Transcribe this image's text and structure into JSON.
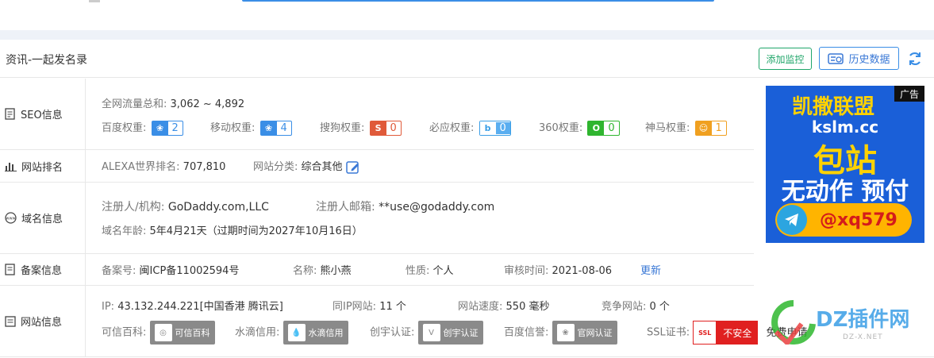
{
  "header": {
    "title": "资讯-一起发名录",
    "monitor_button": "添加监控",
    "history_button": "历史数据"
  },
  "seo": {
    "label": "SEO信息",
    "traffic_label": "全网流量总和:",
    "traffic_value": "3,062 ~ 4,892",
    "weights": [
      {
        "name": "百度权重:",
        "value": "2",
        "icon": "paw-icon",
        "color": "#3a8ee6"
      },
      {
        "name": "移动权重:",
        "value": "4",
        "icon": "paw-icon",
        "color": "#3a8ee6"
      },
      {
        "name": "搜狗权重:",
        "value": "0",
        "icon": "sogou-icon",
        "color": "#e05a3a"
      },
      {
        "name": "必应权重:",
        "value": "0",
        "icon": "bing-icon",
        "color": "#3a9ee6"
      },
      {
        "name": "360权重:",
        "value": "0",
        "icon": "360-icon",
        "color": "#2fb52f"
      },
      {
        "name": "神马权重:",
        "value": "1",
        "icon": "shenma-icon",
        "color": "#f0a020"
      }
    ]
  },
  "rank": {
    "label": "网站排名",
    "alexa_label": "ALEXA世界排名:",
    "alexa_value": "707,810",
    "category_label": "网站分类:",
    "category_value": "综合其他"
  },
  "domain": {
    "label": "域名信息",
    "registrant_label": "注册人/机构:",
    "registrant_value": "GoDaddy.com,LLC",
    "email_label": "注册人邮箱:",
    "email_value": "**use@godaddy.com",
    "age_label": "域名年龄:",
    "age_value": "5年4月21天（过期时间为2027年10月16日）"
  },
  "icp": {
    "label": "备案信息",
    "no_label": "备案号:",
    "no_value": "闽ICP备11002594号",
    "name_label": "名称:",
    "name_value": "熊小燕",
    "nature_label": "性质:",
    "nature_value": "个人",
    "audit_label": "审核时间:",
    "audit_value": "2021-08-06",
    "update_link": "更新"
  },
  "site": {
    "label": "网站信息",
    "ip_label": "IP:",
    "ip_value": "43.132.244.221[中国香港 腾讯云]",
    "sameip_label": "同IP网站:",
    "sameip_value": "11 个",
    "speed_label": "网站速度:",
    "speed_value": "550 毫秒",
    "compete_label": "竞争网站:",
    "compete_value": "0 个",
    "trust_label": "可信百科:",
    "trust_badge": "可信百科",
    "shuidi_label": "水滴信用:",
    "shuidi_badge": "水滴信用",
    "chuangyu_label": "创宇认证:",
    "chuangyu_badge": "创宇认证",
    "baidu_label": "百度信誉:",
    "baidu_badge": "官网认证",
    "ssl_label": "SSL证书:",
    "ssl_badge": "不安全",
    "ssl_tag": "SSL",
    "free_apply": "免费申请"
  },
  "ad": {
    "tag": "广告",
    "line1": "凯撒联盟",
    "line2": "kslm.cc",
    "line3": "包站",
    "line4": "无动作 预付",
    "contact": "@xq579"
  },
  "watermark": {
    "brand": "DZ插件网",
    "url": "DZ-X.NET"
  }
}
